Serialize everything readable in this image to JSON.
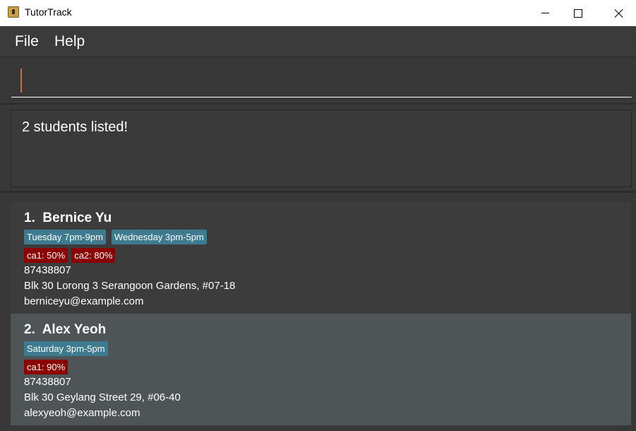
{
  "window": {
    "title": "TutorTrack",
    "minimize_icon": "minimize-icon",
    "maximize_icon": "maximize-icon",
    "close_icon": "close-icon"
  },
  "menu": {
    "file": "File",
    "help": "Help"
  },
  "command": {
    "value": "",
    "placeholder": ""
  },
  "result": {
    "message": "2 students listed!"
  },
  "students": [
    {
      "index_name": "1.  Bernice Yu",
      "times": [
        "Tuesday 7pm-9pm",
        "Wednesday 3pm-5pm"
      ],
      "grades": [
        "ca1: 50%",
        "ca2: 80%"
      ],
      "phone": "87438807",
      "address": "Blk 30 Lorong 3 Serangoon Gardens, #07-18",
      "email": "berniceyu@example.com"
    },
    {
      "index_name": "2.  Alex Yeoh",
      "times": [
        "Saturday 3pm-5pm"
      ],
      "grades": [
        "ca1: 90%"
      ],
      "phone": "87438807",
      "address": "Blk 30 Geylang Street 29, #06-40",
      "email": "alexyeoh@example.com"
    }
  ],
  "colors": {
    "background": "#383838",
    "time_tag": "#3e7b91",
    "grade_tag": "#8b0000",
    "selected_card": "#4f5457"
  }
}
